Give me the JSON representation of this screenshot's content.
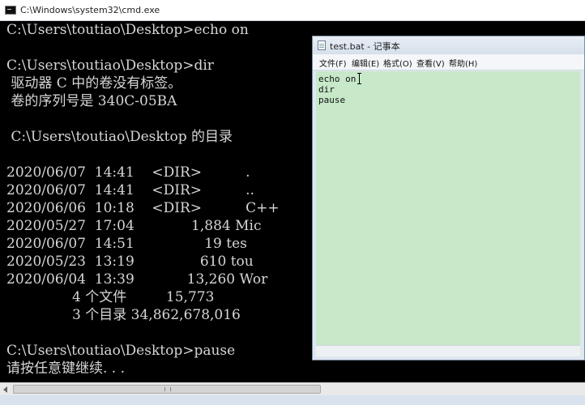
{
  "cmd": {
    "title": "C:\\Windows\\system32\\cmd.exe",
    "lines": [
      "C:\\Users\\toutiao\\Desktop>echo on",
      "",
      "C:\\Users\\toutiao\\Desktop>dir",
      " 驱动器 C 中的卷没有标签。",
      " 卷的序列号是 340C-05BA",
      "",
      " C:\\Users\\toutiao\\Desktop 的目录",
      "",
      "2020/06/07  14:41    <DIR>          .",
      "2020/06/07  14:41    <DIR>          ..",
      "2020/06/06  10:18    <DIR>          C++",
      "2020/05/27  17:04             1,884 Mic",
      "2020/06/07  14:51                19 tes",
      "2020/05/23  13:19               610 tou",
      "2020/06/04  13:39            13,260 Wor",
      "               4 个文件         15,773",
      "               3 个目录 34,862,678,016",
      "",
      "C:\\Users\\toutiao\\Desktop>pause",
      "请按任意键继续. . ."
    ]
  },
  "notepad": {
    "title": "test.bat - 记事本",
    "menu": [
      "文件(F)",
      "编辑(E)",
      "格式(O)",
      "查看(V)",
      "帮助(H)"
    ],
    "lines": [
      "echo on",
      "dir",
      "pause"
    ]
  },
  "colors": {
    "console_bg": "#000000",
    "console_text": "#d6d6d6",
    "notepad_text_bg": "#c7e8c9"
  },
  "icons": {
    "cmd": "cmd-window-icon",
    "notepad": "notepad-icon"
  }
}
